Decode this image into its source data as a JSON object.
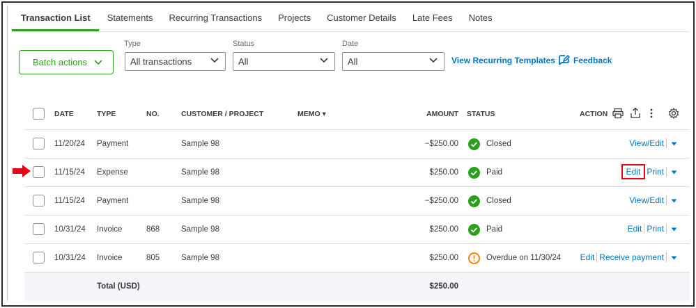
{
  "tabs": [
    {
      "label": "Transaction List",
      "active": true
    },
    {
      "label": "Statements"
    },
    {
      "label": "Recurring Transactions"
    },
    {
      "label": "Projects"
    },
    {
      "label": "Customer Details"
    },
    {
      "label": "Late Fees"
    },
    {
      "label": "Notes"
    }
  ],
  "filters": {
    "batch_label": "Batch actions",
    "type_label": "Type",
    "type_value": "All transactions",
    "status_label": "Status",
    "status_value": "All",
    "date_label": "Date",
    "date_value": "All",
    "recurring_link": "View Recurring Templates",
    "feedback_link": "Feedback"
  },
  "table": {
    "headers": {
      "date": "DATE",
      "type": "TYPE",
      "no": "NO.",
      "customer": "CUSTOMER / PROJECT",
      "memo": "MEMO ▾",
      "amount": "AMOUNT",
      "status": "STATUS",
      "action": "ACTION"
    },
    "rows": [
      {
        "date": "11/20/24",
        "type": "Payment",
        "no": "",
        "customer": "Sample 98",
        "amount": "−$250.00",
        "status": "Closed",
        "status_kind": "ok"
      },
      {
        "date": "11/15/24",
        "type": "Expense",
        "no": "",
        "customer": "Sample 98",
        "amount": "$250.00",
        "status": "Paid",
        "status_kind": "ok"
      },
      {
        "date": "11/15/24",
        "type": "Payment",
        "no": "",
        "customer": "Sample 98",
        "amount": "−$250.00",
        "status": "Closed",
        "status_kind": "ok"
      },
      {
        "date": "10/31/24",
        "type": "Invoice",
        "no": "868",
        "customer": "Sample 98",
        "amount": "$250.00",
        "status": "Paid",
        "status_kind": "ok"
      },
      {
        "date": "10/31/24",
        "type": "Invoice",
        "no": "805",
        "customer": "Sample 98",
        "amount": "$250.00",
        "status": "Overdue on 11/30/24",
        "status_kind": "warn"
      }
    ],
    "actions": {
      "view_edit": "View/Edit",
      "edit": "Edit",
      "print": "Print",
      "receive_payment": "Receive payment"
    },
    "total_label": "Total (USD)",
    "total_amount": "$250.00"
  },
  "colors": {
    "accent": "#2ca01c",
    "link": "#0077c5",
    "warning": "#ff8000",
    "highlight": "#e30613"
  },
  "icons": [
    "chevron-down-icon",
    "feedback-icon",
    "print-icon",
    "export-icon",
    "more-icon",
    "settings-icon",
    "check-icon",
    "warning-icon",
    "red-arrow-icon"
  ]
}
